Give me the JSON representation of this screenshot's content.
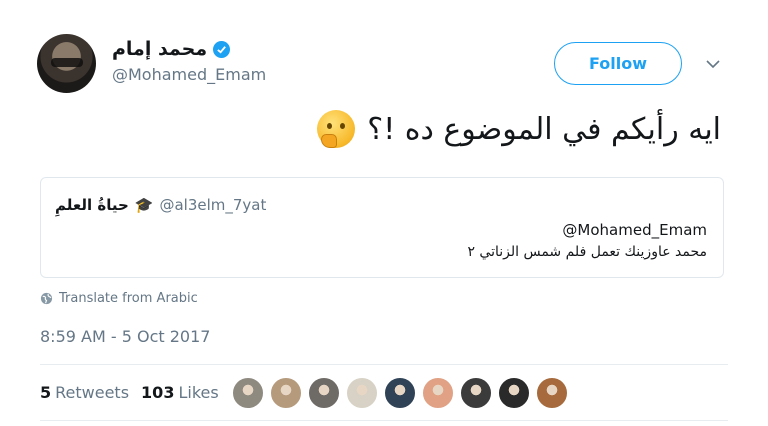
{
  "author": {
    "display_name": "محمد إمام",
    "handle": "@Mohamed_Emam"
  },
  "follow_label": "Follow",
  "tweet_text": "ايه رأيكم في الموضوع ده !؟",
  "quoted_tweet": {
    "display_name": "حياةُ العلمِ",
    "handle": "@al3elm_7yat",
    "mention": "@Mohamed_Emam",
    "text": "محمد عاوزينك تعمل فلم شمس الزناتي ٢"
  },
  "translate_label": "Translate from Arabic",
  "timestamp": "8:59 AM - 5 Oct 2017",
  "stats": {
    "retweets_count": "5",
    "retweets_label": "Retweets",
    "likes_count": "103",
    "likes_label": "Likes"
  },
  "liker_colors": [
    "#8f8a80",
    "#b59a7c",
    "#6e6a66",
    "#d7d2c5",
    "#2f4256",
    "#e0a184",
    "#3b3b3b",
    "#2a2a2a",
    "#a66a3c"
  ],
  "colors": {
    "accent": "#1da1f2",
    "secondary_text": "#657786"
  }
}
